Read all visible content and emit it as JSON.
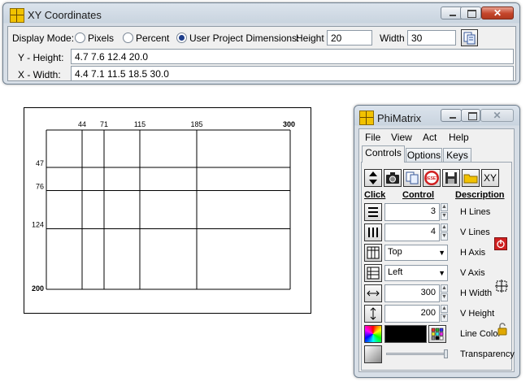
{
  "xy_window": {
    "title": "XY Coordinates",
    "display_mode_label": "Display Mode:",
    "modes": [
      "Pixels",
      "Percent",
      "User Project Dimensions:"
    ],
    "selected_mode": "User Project Dimensions:",
    "height_label": "Height",
    "height_value": "20",
    "width_label": "Width",
    "width_value": "30",
    "y_label": "Y - Height:",
    "y_values": "4.7  7.6  12.4  20.0",
    "x_label": "X - Width:",
    "x_values": "4.4  7.1  11.5  18.5  30.0"
  },
  "grid_preview": {
    "x_ticks": [
      "44",
      "71",
      "115",
      "185",
      "300"
    ],
    "y_ticks": [
      "47",
      "76",
      "124",
      "200"
    ],
    "x_positions": [
      44,
      71,
      115,
      185,
      300
    ],
    "y_positions": [
      47,
      76,
      124,
      200
    ],
    "x_max": 300,
    "y_max": 200
  },
  "phimatrix": {
    "title": "PhiMatrix",
    "menu": [
      "File",
      "View",
      "Act",
      "Help"
    ],
    "tabs": [
      "Controls",
      "Options",
      "Keys"
    ],
    "active_tab": "Controls",
    "toolbar_icons": [
      "move-updown-icon",
      "camera-icon",
      "copy-icon",
      "reset-icon",
      "save-icon",
      "folder-icon",
      "xy-icon"
    ],
    "xy_button_label": "XY",
    "reset_label": "RESET",
    "headers": {
      "click": "Click",
      "control": "Control",
      "description": "Description"
    },
    "h_lines": {
      "value": "3",
      "label": "H Lines"
    },
    "v_lines": {
      "value": "4",
      "label": "V Lines"
    },
    "h_axis": {
      "value": "Top",
      "label": "H Axis"
    },
    "v_axis": {
      "value": "Left",
      "label": "V Axis"
    },
    "h_width": {
      "value": "300",
      "label": "H Width"
    },
    "v_height": {
      "value": "200",
      "label": "V Height"
    },
    "line_color": {
      "value": "#000000",
      "label": "Line Color"
    },
    "transparency": {
      "label": "Transparency",
      "level": 1.0
    }
  },
  "colors": {
    "accent_red": "#d02020",
    "grid_line": "#000000"
  }
}
